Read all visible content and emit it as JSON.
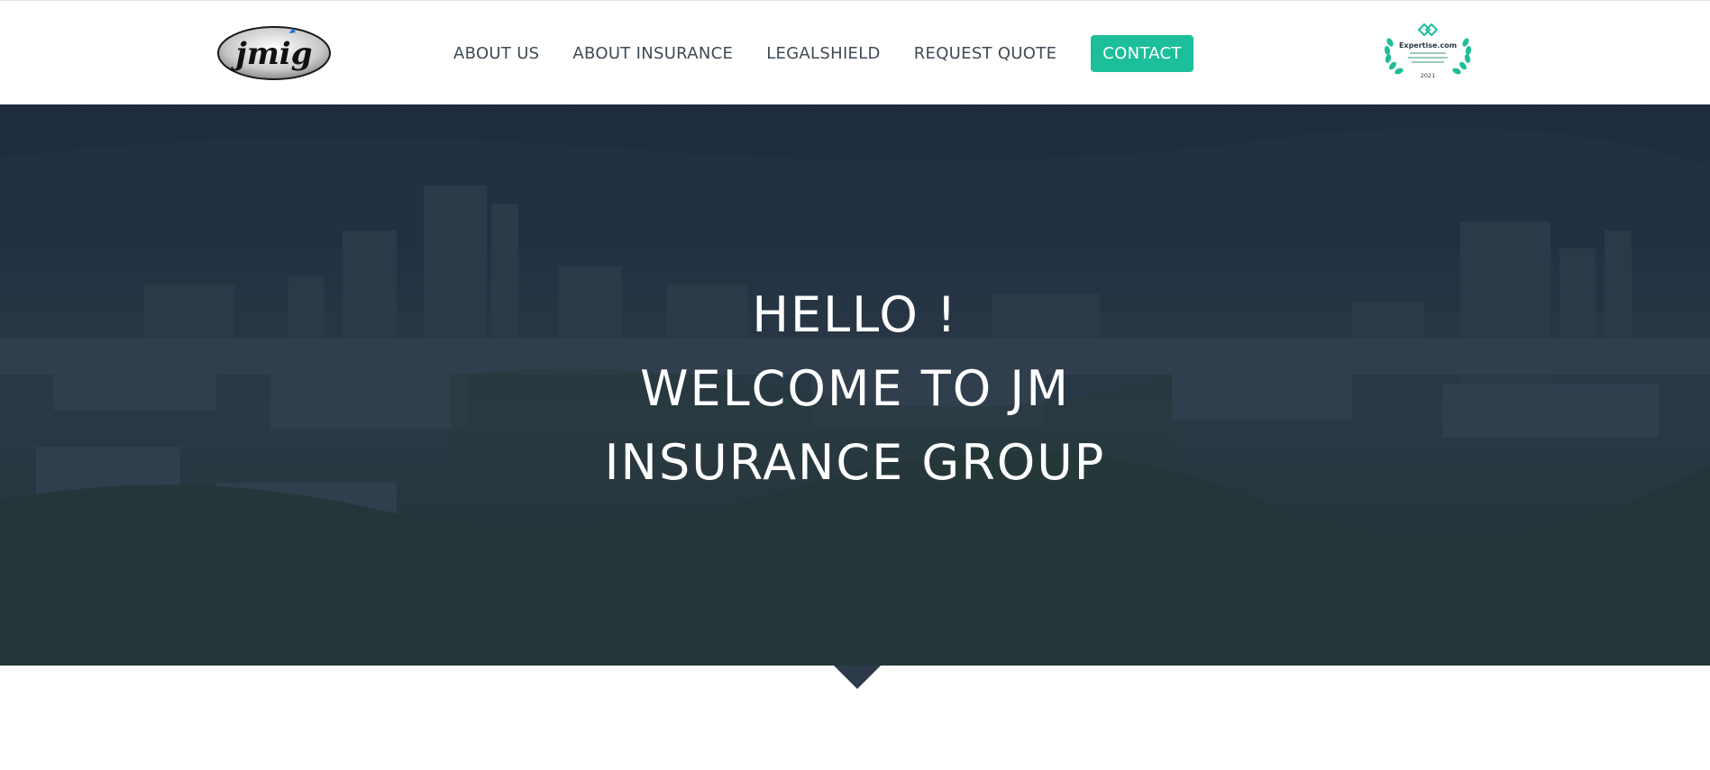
{
  "header": {
    "logo_text": "jmig",
    "nav": [
      {
        "label": "ABOUT US"
      },
      {
        "label": "ABOUT INSURANCE"
      },
      {
        "label": "LEGALSHIELD"
      },
      {
        "label": "REQUEST QUOTE"
      },
      {
        "label": "CONTACT"
      }
    ],
    "badge": {
      "brand": "Expertise.com",
      "year": "2021"
    }
  },
  "hero": {
    "lines": [
      "HELLO !",
      "WELCOME TO JM",
      "INSURANCE GROUP"
    ]
  },
  "colors": {
    "accent": "#1dbf9a",
    "nav_text": "#3f4a55",
    "hero_overlay": "#1e2c3e",
    "hero_text": "#ffffff"
  }
}
